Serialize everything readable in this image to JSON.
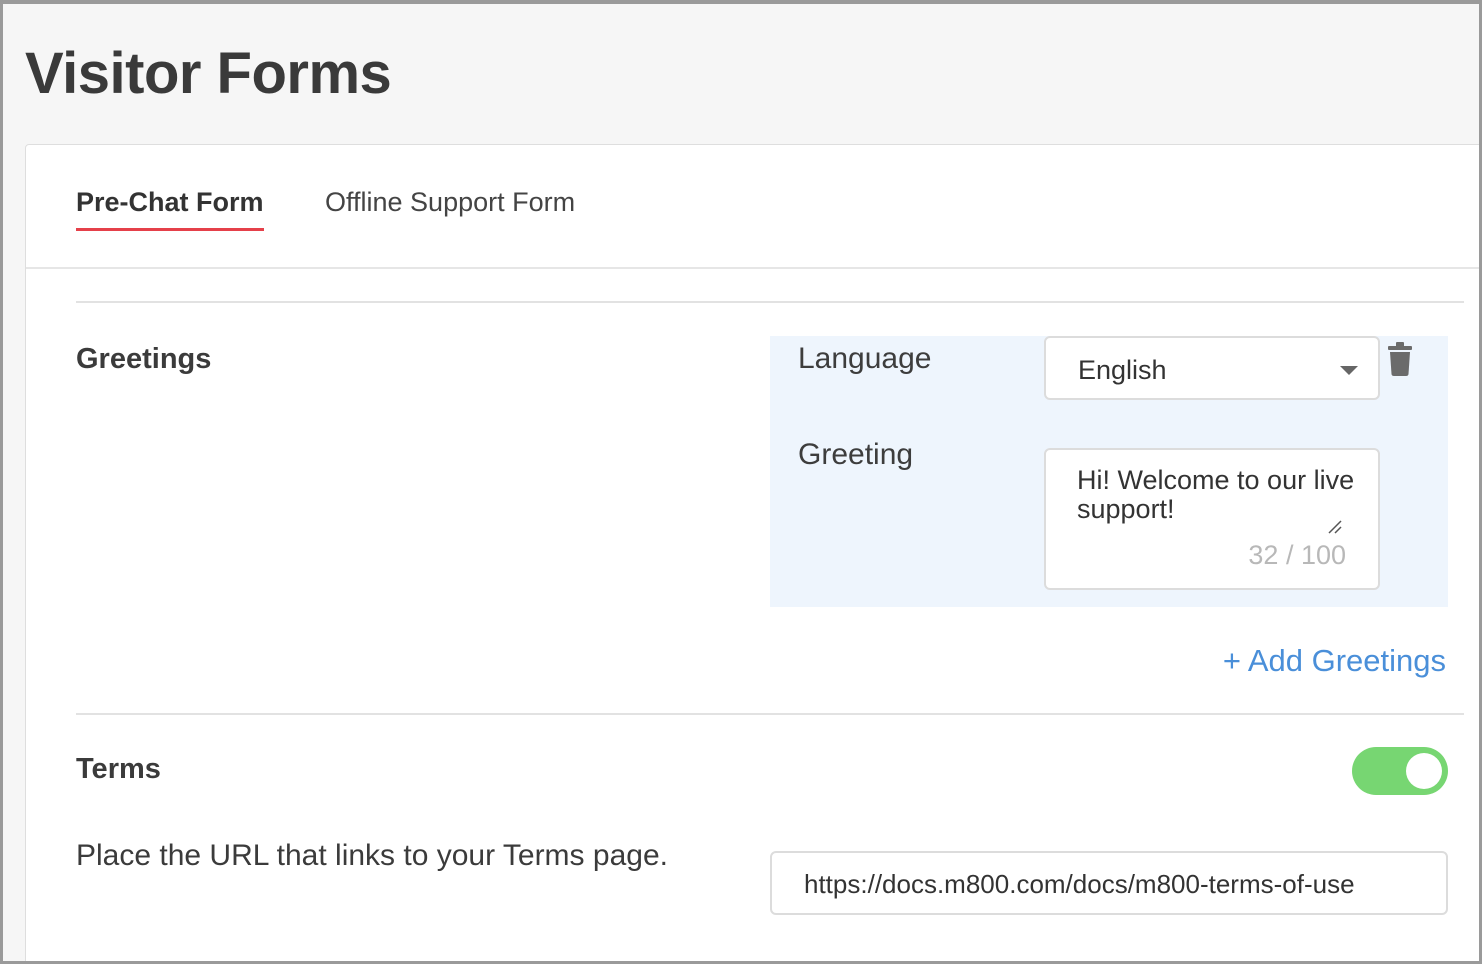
{
  "page": {
    "title": "Visitor Forms"
  },
  "tabs": [
    {
      "label": "Pre-Chat Form",
      "active": true
    },
    {
      "label": "Offline Support Form",
      "active": false
    }
  ],
  "greetings": {
    "section_label": "Greetings",
    "language_label": "Language",
    "language_value": "English",
    "greeting_label": "Greeting",
    "greeting_value": "Hi! Welcome to our live support!",
    "char_count": "32 / 100",
    "add_link": "+ Add Greetings"
  },
  "terms": {
    "section_label": "Terms",
    "enabled": true,
    "description": "Place the URL that links to your Terms page.",
    "url_value": "https://docs.m800.com/docs/m800-terms-of-use"
  },
  "colors": {
    "accent_tab_underline": "#e5404a",
    "link": "#4a8fd9",
    "toggle_on": "#77d672",
    "greeting_panel_bg": "#eef5fd"
  }
}
